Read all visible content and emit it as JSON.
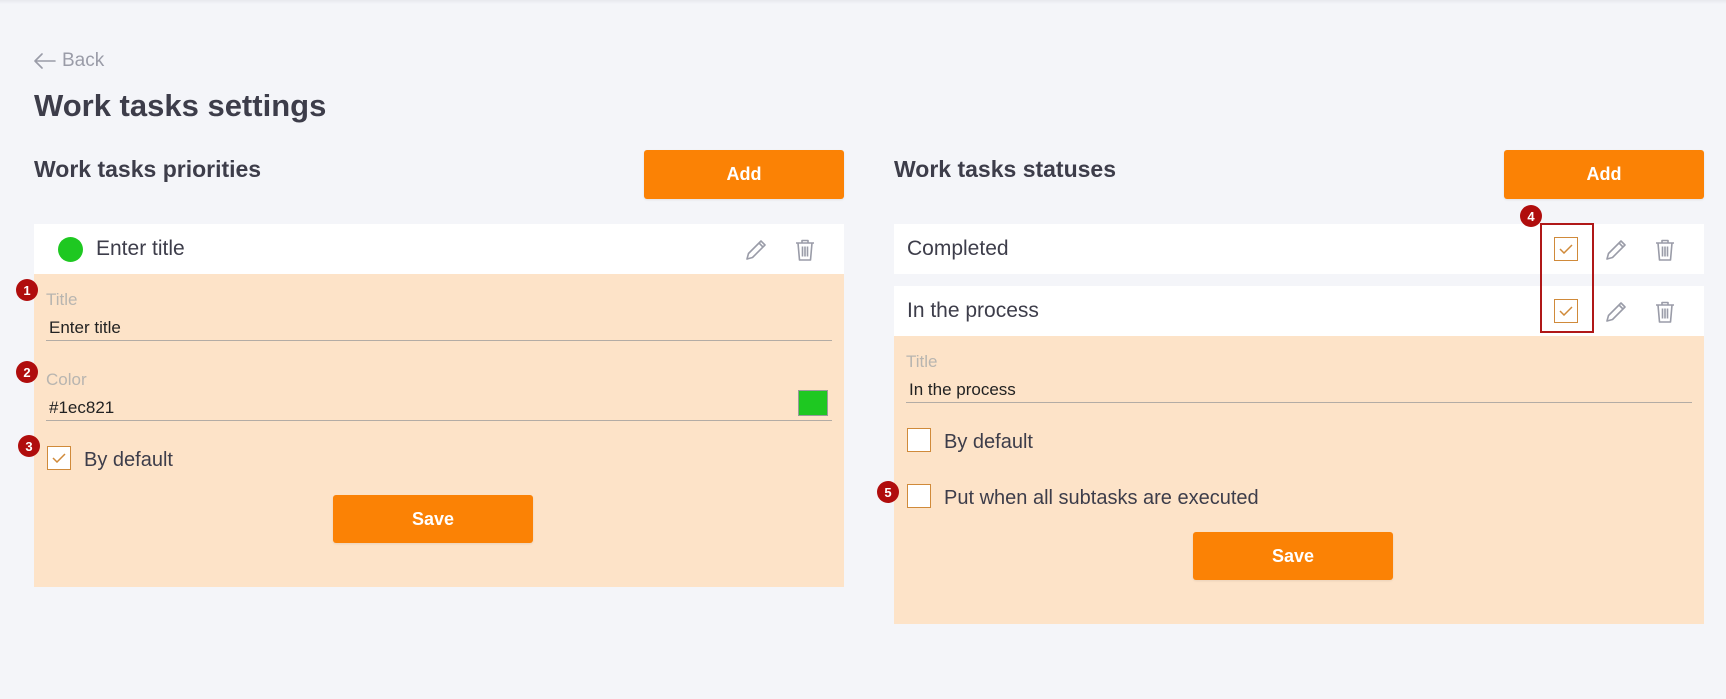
{
  "nav": {
    "back_label": "Back"
  },
  "page": {
    "title": "Work tasks settings"
  },
  "priorities": {
    "title": "Work tasks priorities",
    "add_label": "Add",
    "item": {
      "label": "Enter title",
      "color": "#1ec821"
    },
    "form": {
      "title_label": "Title",
      "title_value": "Enter title",
      "color_label": "Color",
      "color_value": "#1ec821",
      "by_default_label": "By default",
      "by_default_checked": true,
      "save_label": "Save"
    }
  },
  "statuses": {
    "title": "Work tasks statuses",
    "add_label": "Add",
    "items": [
      {
        "label": "Completed",
        "checked": true
      },
      {
        "label": "In the process",
        "checked": true
      }
    ],
    "form": {
      "title_label": "Title",
      "title_value": "In the process",
      "by_default_label": "By default",
      "by_default_checked": false,
      "subtasks_label": "Put when all subtasks are executed",
      "subtasks_checked": false,
      "save_label": "Save"
    }
  },
  "annotations": [
    "1",
    "2",
    "3",
    "4",
    "5"
  ],
  "colors": {
    "accent": "#fb8205",
    "panel": "#fde3c8",
    "badge": "#b00d0d",
    "swatch": "#1ec821"
  }
}
